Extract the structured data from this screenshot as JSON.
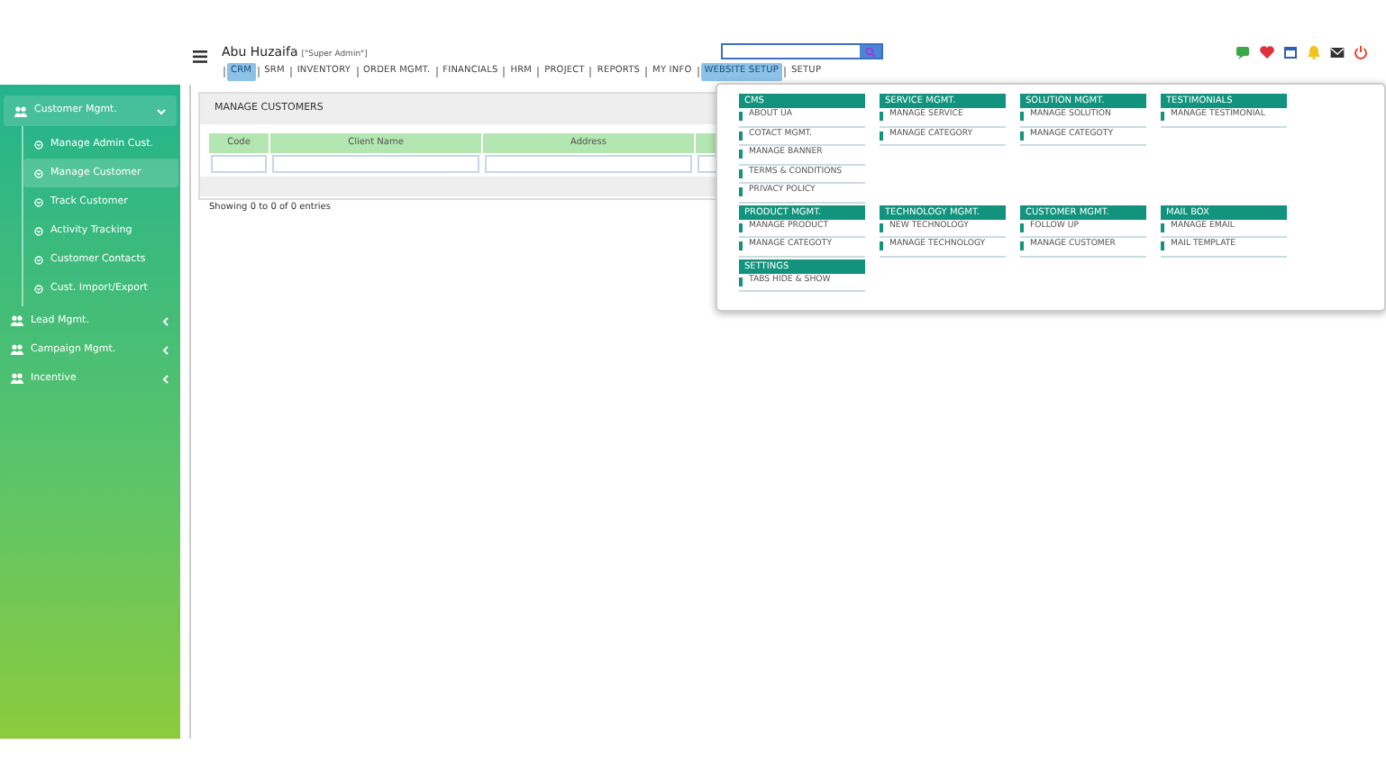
{
  "header": {
    "user_name": "Abu Huzaifa",
    "user_role": "[\"Super Admin\"]"
  },
  "top_nav": [
    {
      "label": "CRM",
      "selected": true
    },
    {
      "label": "SRM",
      "selected": false
    },
    {
      "label": "INVENTORY",
      "selected": false
    },
    {
      "label": "ORDER MGMT.",
      "selected": false
    },
    {
      "label": "FINANCIALS",
      "selected": false
    },
    {
      "label": "HRM",
      "selected": false
    },
    {
      "label": "PROJECT",
      "selected": false
    },
    {
      "label": "REPORTS",
      "selected": false
    },
    {
      "label": "MY INFO",
      "selected": false
    },
    {
      "label": "WEBSITE SETUP",
      "selected": true
    },
    {
      "label": "SETUP",
      "selected": false
    }
  ],
  "header_icons": [
    {
      "kind": "chat",
      "color": "#3aa845"
    },
    {
      "kind": "heart",
      "color": "#e0303a"
    },
    {
      "kind": "calendar",
      "color": "#2d5fb8"
    },
    {
      "kind": "bell",
      "color": "#f2c318"
    },
    {
      "kind": "mail",
      "color": "#333333"
    },
    {
      "kind": "power",
      "color": "#e8412c"
    }
  ],
  "sidebar": {
    "items": [
      {
        "label": "Customer Mgmt.",
        "expanded": true,
        "selected": true,
        "children": [
          {
            "label": "Manage Admin Cust.",
            "selected": false
          },
          {
            "label": "Manage Customer",
            "selected": true
          },
          {
            "label": "Track Customer",
            "selected": false
          },
          {
            "label": "Activity Tracking",
            "selected": false
          },
          {
            "label": "Customer Contacts",
            "selected": false
          },
          {
            "label": "Cust. Import/Export",
            "selected": false
          }
        ]
      },
      {
        "label": "Lead Mgmt.",
        "expanded": false,
        "selected": false
      },
      {
        "label": "Campaign Mgmt.",
        "expanded": false,
        "selected": false
      },
      {
        "label": "Incentive",
        "expanded": false,
        "selected": false
      }
    ]
  },
  "panel": {
    "title": "MANAGE CUSTOMERS",
    "columns": [
      {
        "label": "Code"
      },
      {
        "label": "Client Name"
      },
      {
        "label": "Address"
      },
      {
        "kind": "cut"
      }
    ],
    "info": "Showing 0 to 0 of 0 entries"
  },
  "mega_menu": {
    "rows": [
      [
        {
          "title": "CMS",
          "items": [
            "ABOUT UA",
            "COTACT MGMT.",
            "MANAGE BANNER",
            "TERMS & CONDITIONS",
            "PRIVACY POLICY"
          ]
        },
        {
          "title": "SERVICE MGMT.",
          "items": [
            "MANAGE SERVICE",
            "MANAGE CATEGORY"
          ]
        },
        {
          "title": "SOLUTION MGMT.",
          "items": [
            "MANAGE SOLUTION",
            "MANAGE CATEGOTY"
          ]
        },
        {
          "title": "TESTIMONIALS",
          "items": [
            "MANAGE TESTIMONIAL"
          ]
        }
      ],
      [
        {
          "title": "PRODUCT MGMT.",
          "items": [
            "MANAGE PRODUCT",
            "MANAGE CATEGOTY"
          ]
        },
        {
          "title": "TECHNOLOGY MGMT.",
          "items": [
            "NEW TECHNOLOGY",
            "MANAGE TECHNOLOGY"
          ]
        },
        {
          "title": "CUSTOMER MGMT.",
          "items": [
            "FOLLOW UP",
            "MANAGE CUSTOMER"
          ]
        },
        {
          "title": "MAIL BOX",
          "items": [
            "MANAGE EMAIL",
            "MAIL TEMPLATE"
          ]
        }
      ],
      [
        {
          "title": "SETTINGS",
          "items": [
            "TABS HIDE & SHOW"
          ]
        }
      ]
    ]
  }
}
